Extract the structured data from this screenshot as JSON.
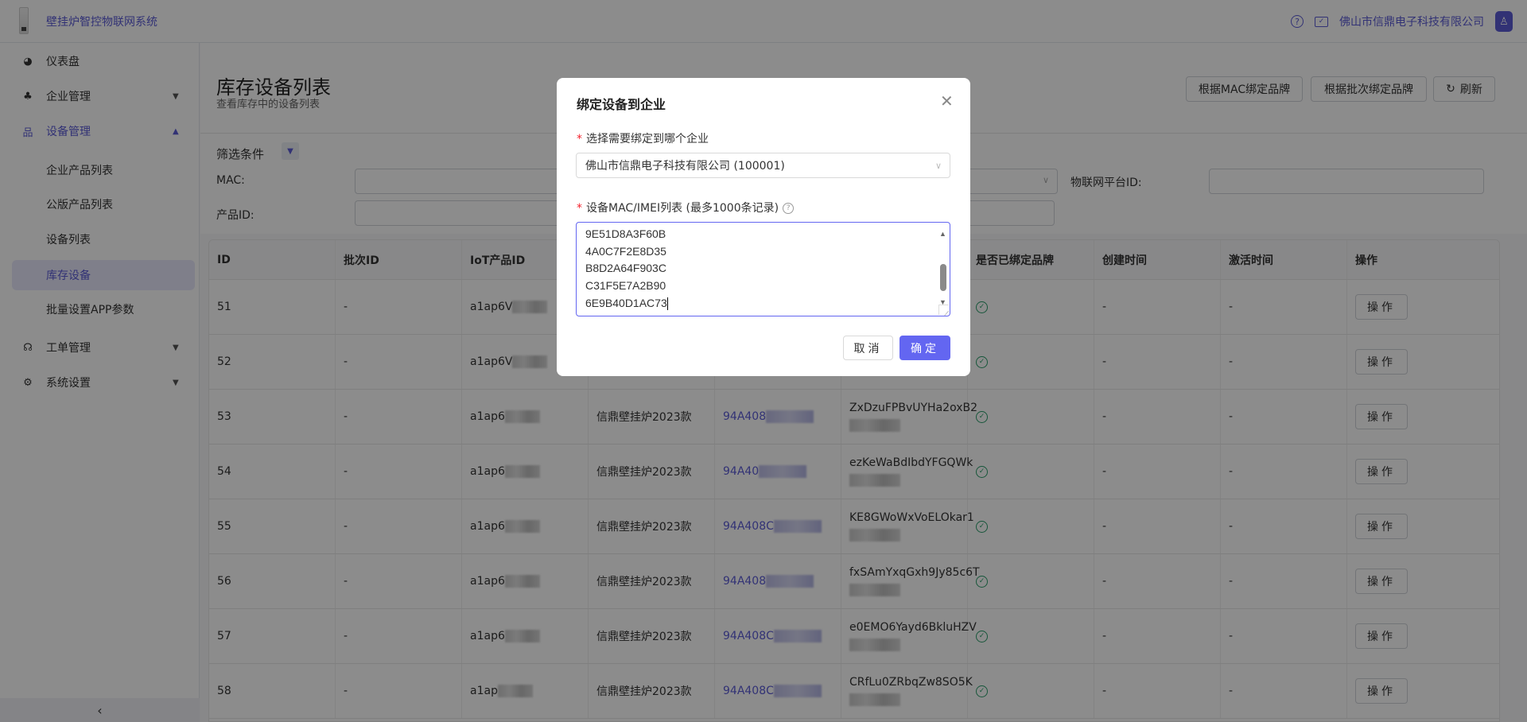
{
  "header": {
    "app_title": "壁挂炉智控物联网系统",
    "company": "佛山市信鼎电子科技有限公司",
    "icons": [
      "help-icon",
      "mail-icon",
      "user-avatar-icon"
    ]
  },
  "sidebar": {
    "items": [
      {
        "label": "仪表盘",
        "icon": "dashboard-icon"
      },
      {
        "label": "企业管理",
        "icon": "org-chart-icon"
      },
      {
        "label": "设备管理",
        "icon": "device-tree-icon"
      },
      {
        "label": "工单管理",
        "icon": "headset-icon"
      },
      {
        "label": "系统设置",
        "icon": "gears-icon"
      }
    ],
    "sub_items": [
      "企业产品列表",
      "公版产品列表",
      "设备列表",
      "库存设备",
      "批量设置APP参数"
    ],
    "collapse": "‹"
  },
  "page": {
    "title": "库存设备列表",
    "subtitle": "查看库存中的设备列表",
    "buttons": {
      "bind_mac": "根据MAC绑定品牌",
      "bind_batch": "根据批次绑定品牌",
      "refresh": "刷新"
    }
  },
  "filter": {
    "title": "筛选条件",
    "mac_label": "MAC:",
    "iot_platform_label": "物联网平台ID:",
    "product_label": "产品ID:"
  },
  "table": {
    "headers": [
      "ID",
      "批次ID",
      "IoT产品ID",
      "",
      "",
      "",
      "是否已绑定品牌",
      "创建时间",
      "激活时间",
      "操作"
    ],
    "rows": [
      {
        "id": "51",
        "batch": "-",
        "iot": "a1ap6V",
        "name": "",
        "mac": "",
        "secret": "",
        "created": "-",
        "activated": "-",
        "op": "操作"
      },
      {
        "id": "52",
        "batch": "-",
        "iot": "a1ap6V",
        "name": "",
        "mac": "",
        "secret": "",
        "created": "-",
        "activated": "-",
        "op": "操作"
      },
      {
        "id": "53",
        "batch": "-",
        "iot": "a1ap6",
        "name": "信鼎壁挂炉2023款",
        "mac": "94A408",
        "secret": "ZxDzuFPBvUYHa2oxB2",
        "created": "-",
        "activated": "-",
        "op": "操作"
      },
      {
        "id": "54",
        "batch": "-",
        "iot": "a1ap6",
        "name": "信鼎壁挂炉2023款",
        "mac": "94A40",
        "secret": "ezKeWaBdIbdYFGQWk",
        "created": "-",
        "activated": "-",
        "op": "操作"
      },
      {
        "id": "55",
        "batch": "-",
        "iot": "a1ap6",
        "name": "信鼎壁挂炉2023款",
        "mac": "94A408C",
        "secret": "KE8GWoWxVoELOkar1",
        "created": "-",
        "activated": "-",
        "op": "操作"
      },
      {
        "id": "56",
        "batch": "-",
        "iot": "a1ap6",
        "name": "信鼎壁挂炉2023款",
        "mac": "94A408",
        "secret": "fxSAmYxqGxh9Jy85c6T",
        "created": "-",
        "activated": "-",
        "op": "操作"
      },
      {
        "id": "57",
        "batch": "-",
        "iot": "a1ap6",
        "name": "信鼎壁挂炉2023款",
        "mac": "94A408C",
        "secret": "e0EMO6Yayd6BkluHZV",
        "created": "-",
        "activated": "-",
        "op": "操作"
      },
      {
        "id": "58",
        "batch": "-",
        "iot": "a1ap",
        "name": "信鼎壁挂炉2023款",
        "mac": "94A408C",
        "secret": "CRfLu0ZRbqZw8SO5K",
        "created": "-",
        "activated": "-",
        "op": "操作"
      }
    ]
  },
  "modal": {
    "title": "绑定设备到企业",
    "company_label": "选择需要绑定到哪个企业",
    "company_value": "佛山市信鼎电子科技有限公司 (100001)",
    "mac_label": "设备MAC/IMEI列表 (最多1000条记录)",
    "mac_lines": [
      "9E51D8A3F60B",
      "4A0C7F2E8D35",
      "B8D2A64F903C",
      "C31F5E7A2B90",
      "6E9B40D1AC73"
    ],
    "cancel": "取消",
    "ok": "确定"
  },
  "colors": {
    "primary": "#6366f1",
    "success": "#2a9d6a"
  }
}
